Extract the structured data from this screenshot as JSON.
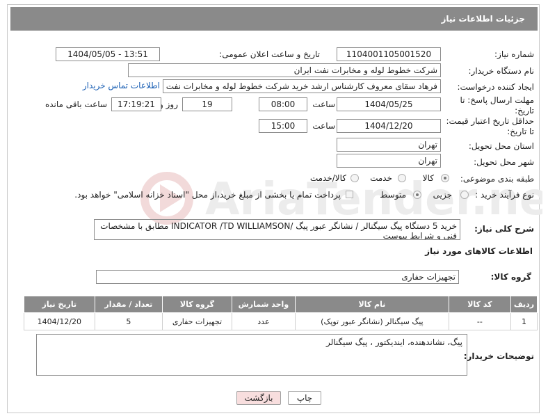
{
  "header": {
    "title": "جزئیات اطلاعات نیاز"
  },
  "fields": {
    "need_number": {
      "label": "شماره نیاز:",
      "value": "1104001105001520"
    },
    "announce_datetime": {
      "label": "تاریخ و ساعت اعلان عمومی:",
      "value": "1404/05/05 - 13:51"
    },
    "buyer_org": {
      "label": "نام دستگاه خریدار:",
      "value": "شرکت خطوط لوله و مخابرات نفت ایران"
    },
    "requester": {
      "label": "ایجاد کننده درخواست:",
      "value": "فرهاد سقای معروف کارشناس ارشد خرید شرکت خطوط لوله و مخابرات نفت ایران",
      "contact_link": "اطلاعات تماس خریدار"
    },
    "reply_deadline": {
      "label": "مهلت ارسال پاسخ: تا تاریخ:",
      "date": "1404/05/25",
      "time_label": "ساعت",
      "time": "08:00",
      "days": "19",
      "days_label": "روز و",
      "remaining": "17:19:21",
      "remaining_label": "ساعت باقی مانده"
    },
    "price_validity": {
      "label": "حداقل تاریخ اعتبار قیمت: تا تاریخ:",
      "date": "1404/12/20",
      "time_label": "ساعت",
      "time": "15:00"
    },
    "delivery_province": {
      "label": "استان محل تحویل:",
      "value": "تهران"
    },
    "delivery_city": {
      "label": "شهر محل تحویل:",
      "value": "تهران"
    },
    "category": {
      "label": "طبقه بندی موضوعی:",
      "options": [
        "کالا",
        "خدمت",
        "کالا/خدمت"
      ],
      "selected": "کالا"
    },
    "process_type": {
      "label": "نوع فرآیند خرید :",
      "options": [
        "جزیی",
        "متوسط"
      ],
      "selected": "متوسط",
      "note": "پرداخت تمام یا بخشی از مبلغ خرید،از محل \"اسناد خزانه اسلامی\" خواهد بود."
    },
    "description": {
      "label": "شرح کلی نیاز:",
      "value": "خرید 5 دستگاه پیگ سیگنالر / نشانگر عبور پیگ /INDICATOR /TD WILLIAMSON مطابق با مشخصات فنی و شرایط پیوست"
    }
  },
  "goods": {
    "section_title": "اطلاعات کالاهای مورد نیاز",
    "group_label": "گروه کالا:",
    "group_value": "تجهیزات حفاری",
    "columns": [
      "ردیف",
      "کد کالا",
      "نام کالا",
      "واحد شمارش",
      "گروه کالا",
      "تعداد / مقدار",
      "تاریخ نیاز"
    ],
    "rows": [
      [
        "1",
        "--",
        "پیگ سیگنالر (نشانگر عبور توپک)",
        "عدد",
        "تجهیزات حفاری",
        "5",
        "1404/12/20"
      ]
    ]
  },
  "buyer_notes": {
    "label": "توضیحات خریدار:",
    "value": "پیگ، نشاندهنده، ایندیکتور ، پیگ سیگنالر"
  },
  "buttons": {
    "print": "چاپ",
    "back": "بازگشت"
  },
  "watermark": {
    "text": "AriaTender.neT"
  },
  "colors": {
    "header_bg": "#8a8a8a",
    "link": "#1a5fb4",
    "back_button_bg": "#f8dede"
  }
}
